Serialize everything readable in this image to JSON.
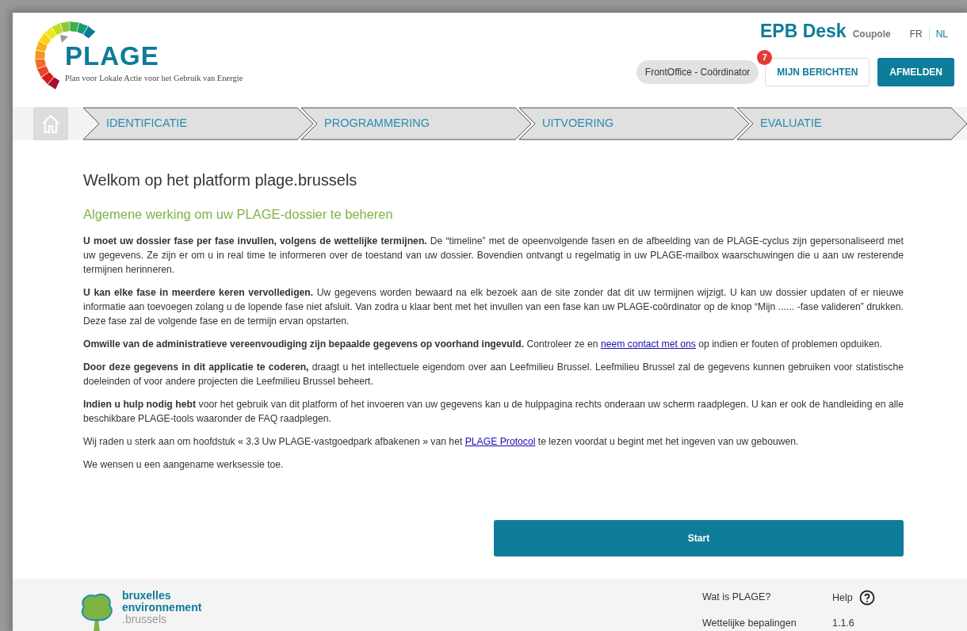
{
  "logo": {
    "title": "PLAGE",
    "subtitle": "Plan voor Lokale Actie voor het Gebruik van Energie"
  },
  "header": {
    "app_name": "EPB Desk",
    "app_suffix": "Coupole",
    "languages": [
      {
        "label": "FR",
        "selected": false
      },
      {
        "label": "NL",
        "selected": true
      }
    ],
    "role": "FrontOffice - Coördinator",
    "messages_button": "MIJN BERICHTEN",
    "messages_count": "7",
    "logout_button": "AFMELDEN"
  },
  "steps": [
    {
      "label": "IDENTIFICATIE"
    },
    {
      "label": "PROGRAMMERING"
    },
    {
      "label": "UITVOERING"
    },
    {
      "label": "EVALUATIE"
    }
  ],
  "content": {
    "title": "Welkom op het platform plage.brussels",
    "subtitle": "Algemene werking om uw PLAGE-dossier te beheren",
    "paragraphs": [
      [
        {
          "kind": "bold",
          "text": "U moet uw dossier fase per fase invullen, volgens de wettelijke termijnen."
        },
        {
          "kind": "plain",
          "text": " De “timeline” met de opeenvolgende fasen en de afbeelding van de PLAGE-cyclus zijn gepersonaliseerd met uw gegevens. Ze zijn er om u in real time te informeren over de toestand van uw dossier. Bovendien ontvangt u regelmatig in uw PLAGE-mailbox waarschuwingen die u aan uw resterende termijnen herinneren."
        }
      ],
      [
        {
          "kind": "bold",
          "text": "U kan elke fase in meerdere keren vervolledigen."
        },
        {
          "kind": "plain",
          "text": " Uw gegevens worden bewaard na elk bezoek aan de site zonder dat dit uw termijnen wijzigt. U kan uw dossier updaten of er nieuwe informatie aan toevoegen zolang u de lopende fase niet afsluit. Van zodra u klaar bent met het invullen van een fase kan uw PLAGE-coördinator op de knop “Mijn ...... -fase valideren” drukken. Deze fase zal de volgende fase en de termijn ervan opstarten."
        }
      ],
      [
        {
          "kind": "bold",
          "text": "Omwille van de administratieve vereenvoudiging zijn bepaalde gegevens op voorhand ingevuld."
        },
        {
          "kind": "plain",
          "text": " Controleer ze en "
        },
        {
          "kind": "link",
          "text": "neem contact met ons"
        },
        {
          "kind": "plain",
          "text": " op indien er fouten of problemen opduiken."
        }
      ],
      [
        {
          "kind": "bold",
          "text": "Door deze gegevens in dit applicatie te coderen,"
        },
        {
          "kind": "plain",
          "text": " draagt u het intellectuele eigendom over aan Leefmilieu Brussel. Leefmilieu Brussel zal de gegevens kunnen gebruiken voor statistische doeleinden of voor andere projecten die Leefmilieu Brussel beheert."
        }
      ],
      [
        {
          "kind": "bold",
          "text": "Indien u hulp nodig hebt"
        },
        {
          "kind": "plain",
          "text": " voor het gebruik van dit platform of het invoeren van uw gegevens kan u de hulppagina rechts onderaan uw scherm raadplegen. U kan er ook de handleiding en alle beschikbare PLAGE-tools waaronder de FAQ raadplegen."
        }
      ],
      [
        {
          "kind": "plain",
          "text": "Wij raden u sterk aan om hoofdstuk « 3.3 Uw PLAGE-vastgoedpark afbakenen » van het "
        },
        {
          "kind": "link",
          "text": "PLAGE Protocol"
        },
        {
          "kind": "plain",
          "text": " te lezen voordat u begint met het ingeven van uw gebouwen."
        }
      ],
      [
        {
          "kind": "plain",
          "text": "We wensen u een aangename werksessie toe."
        }
      ]
    ],
    "start_button": "Start"
  },
  "footer": {
    "org_line1": "bruxelles",
    "org_line2": "environnement",
    "org_domain": ".brussels",
    "links": [
      {
        "label": "Wat is PLAGE?",
        "kind": "link"
      },
      {
        "label": "Help",
        "kind": "help"
      },
      {
        "label": "Wettelijke bepalingen",
        "kind": "link"
      },
      {
        "label": "1.1.6",
        "kind": "version"
      }
    ]
  }
}
